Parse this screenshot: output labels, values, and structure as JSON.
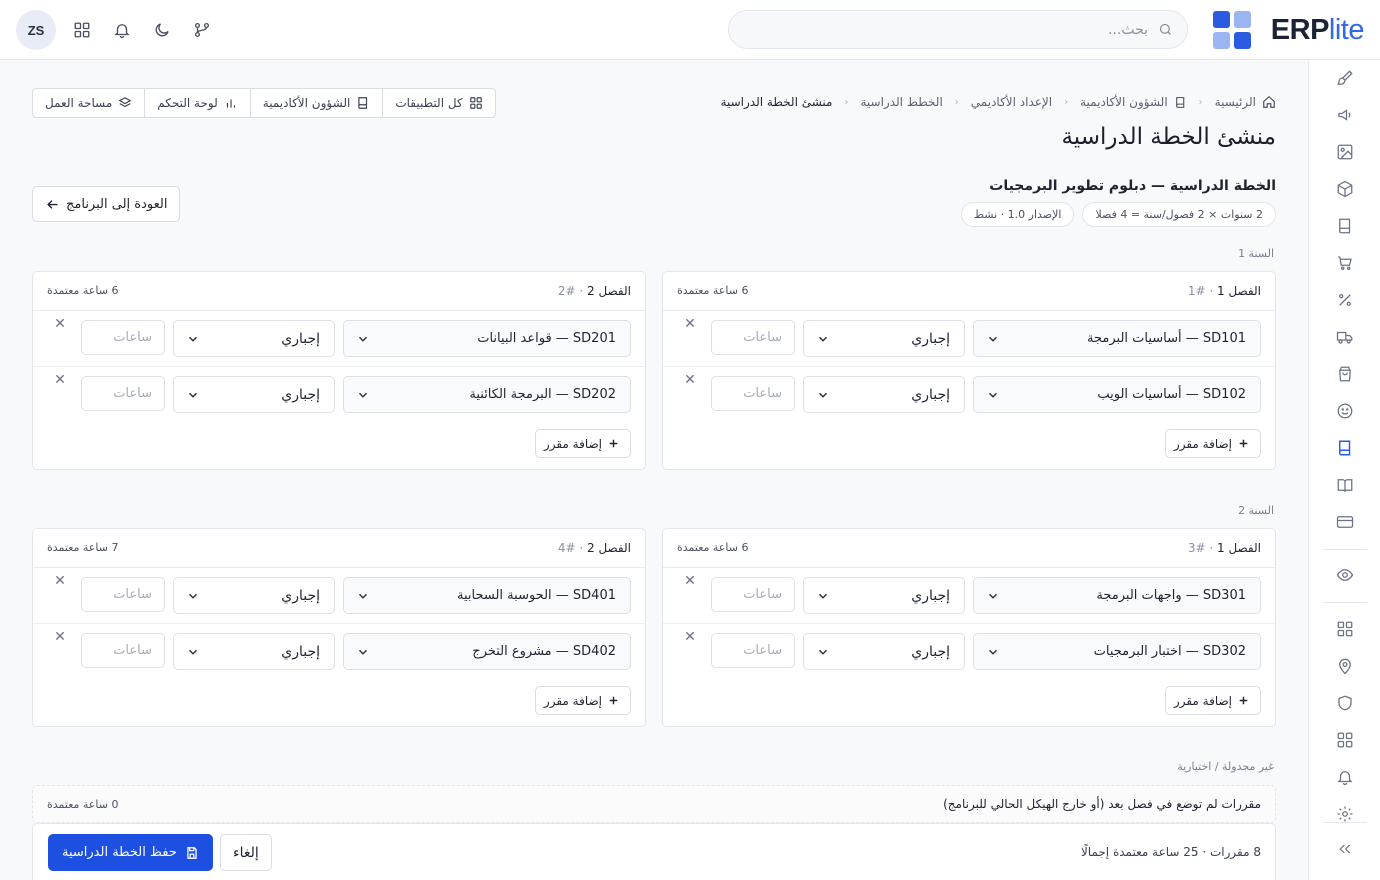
{
  "brand": {
    "name_main": "ERP",
    "name_accent": "lite",
    "colors": [
      "#2b5be0",
      "#9bb5f3",
      "#9bb5f3",
      "#2b5be0"
    ]
  },
  "search": {
    "placeholder": "بحث..."
  },
  "user": {
    "initials": "ZS"
  },
  "top_icons": [
    "apps-grid-icon",
    "bell-icon",
    "moon-icon",
    "git-branch-icon"
  ],
  "rail_icons": [
    "brush-icon",
    "megaphone-icon",
    "image-icon",
    "cube-icon",
    "book-icon",
    "cart-icon",
    "percent-icon",
    "truck-icon",
    "bag-icon",
    "smile-icon",
    "notebook-icon",
    "book-open-icon",
    "card-icon",
    "eye-icon",
    "grid-icon",
    "location-icon",
    "shield-icon",
    "grid-icon",
    "bell-icon",
    "gear-icon",
    "chevrons-left-icon"
  ],
  "rail_active": "notebook-icon",
  "breadcrumb": [
    "الرئيسية",
    "الشؤون الأكاديمية",
    "الإعداد الأكاديمي",
    "الخطط الدراسية",
    "منشئ الخطة الدراسية"
  ],
  "quick_nav": [
    "كل التطبيقات",
    "الشؤون الأكاديمية",
    "لوحة التحكم",
    "مساحة العمل"
  ],
  "page_title": "منشئ الخطة الدراسية",
  "plan": {
    "title": "الخطة الدراسية — دبلوم تطوير البرمجيات",
    "structure_chip": "2 سنوات × 2 فصول/سنة = 4 فصلا",
    "version_chip": "الإصدار 1.0 · نشط"
  },
  "back_button": "العودة إلى البرنامج",
  "years": [
    {
      "label": "السنة 1",
      "semesters": [
        {
          "name": "الفصل 1",
          "num": "· #1",
          "hours": "6 ساعة معتمدة",
          "courses": [
            {
              "course": "SD101 — أساسيات البرمجة",
              "type": "إجباري"
            },
            {
              "course": "SD102 — أساسيات الويب",
              "type": "إجباري"
            }
          ]
        },
        {
          "name": "الفصل 2",
          "num": "· #2",
          "hours": "6 ساعة معتمدة",
          "courses": [
            {
              "course": "SD201 — قواعد البيانات",
              "type": "إجباري"
            },
            {
              "course": "SD202 — البرمجة الكائنية",
              "type": "إجباري"
            }
          ]
        }
      ]
    },
    {
      "label": "السنة 2",
      "semesters": [
        {
          "name": "الفصل 1",
          "num": "· #3",
          "hours": "6 ساعة معتمدة",
          "courses": [
            {
              "course": "SD301 — واجهات البرمجة",
              "type": "إجباري"
            },
            {
              "course": "SD302 — اختبار البرمجيات",
              "type": "إجباري"
            }
          ]
        },
        {
          "name": "الفصل 2",
          "num": "· #4",
          "hours": "7 ساعة معتمدة",
          "courses": [
            {
              "course": "SD401 — الحوسبة السحابية",
              "type": "إجباري"
            },
            {
              "course": "SD402 — مشروع التخرج",
              "type": "إجباري"
            }
          ]
        }
      ]
    }
  ],
  "hours_placeholder": "ساعات",
  "add_course_label": "إضافة مقرر",
  "unscheduled": {
    "label": "غير مجدولة / اختيارية",
    "text": "مقررات لم توضع في فصل بعد (أو خارج الهيكل الحالي للبرنامج)",
    "hours": "0 ساعة معتمدة"
  },
  "footer": {
    "summary": "8 مقررات · 25 ساعة معتمدة إجمالًا",
    "cancel": "إلغاء",
    "save": "حفظ الخطة الدراسية"
  }
}
